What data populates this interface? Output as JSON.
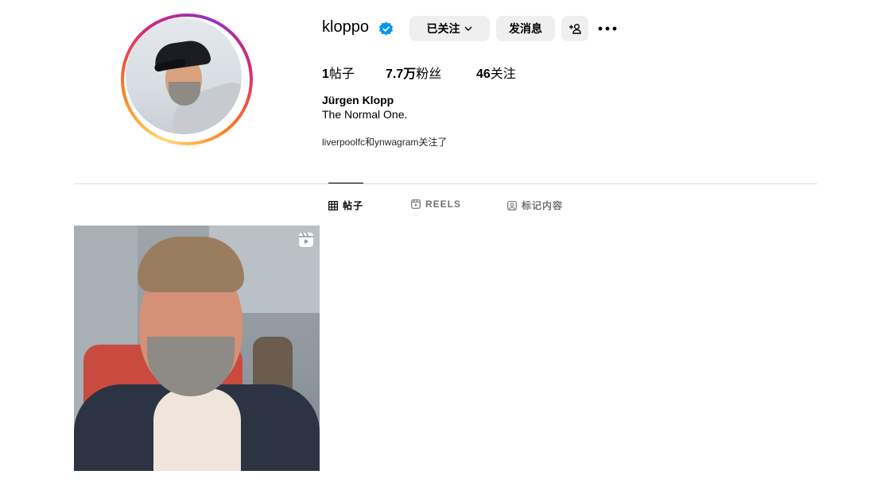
{
  "profile": {
    "username": "kloppo",
    "verified": true,
    "following_label": "已关注",
    "message_label": "发消息",
    "stats": {
      "posts_count": "1",
      "posts_label": "帖子",
      "followers_count": "7.7万",
      "followers_label": "粉丝",
      "following_count": "46",
      "following_label": "关注"
    },
    "full_name": "Jürgen Klopp",
    "bio": "The Normal One.",
    "followed_by": "liverpoolfc和ynwagram关注了"
  },
  "tabs": [
    {
      "label": "帖子",
      "icon": "grid-icon",
      "active": true
    },
    {
      "label": "REELS",
      "icon": "reels-icon",
      "active": false
    },
    {
      "label": "标记内容",
      "icon": "tagged-icon",
      "active": false
    }
  ],
  "colors": {
    "verified_blue": "#0095f6",
    "button_gray": "#efefef",
    "divider": "#dbdbdb",
    "inactive_tab": "#737373"
  }
}
